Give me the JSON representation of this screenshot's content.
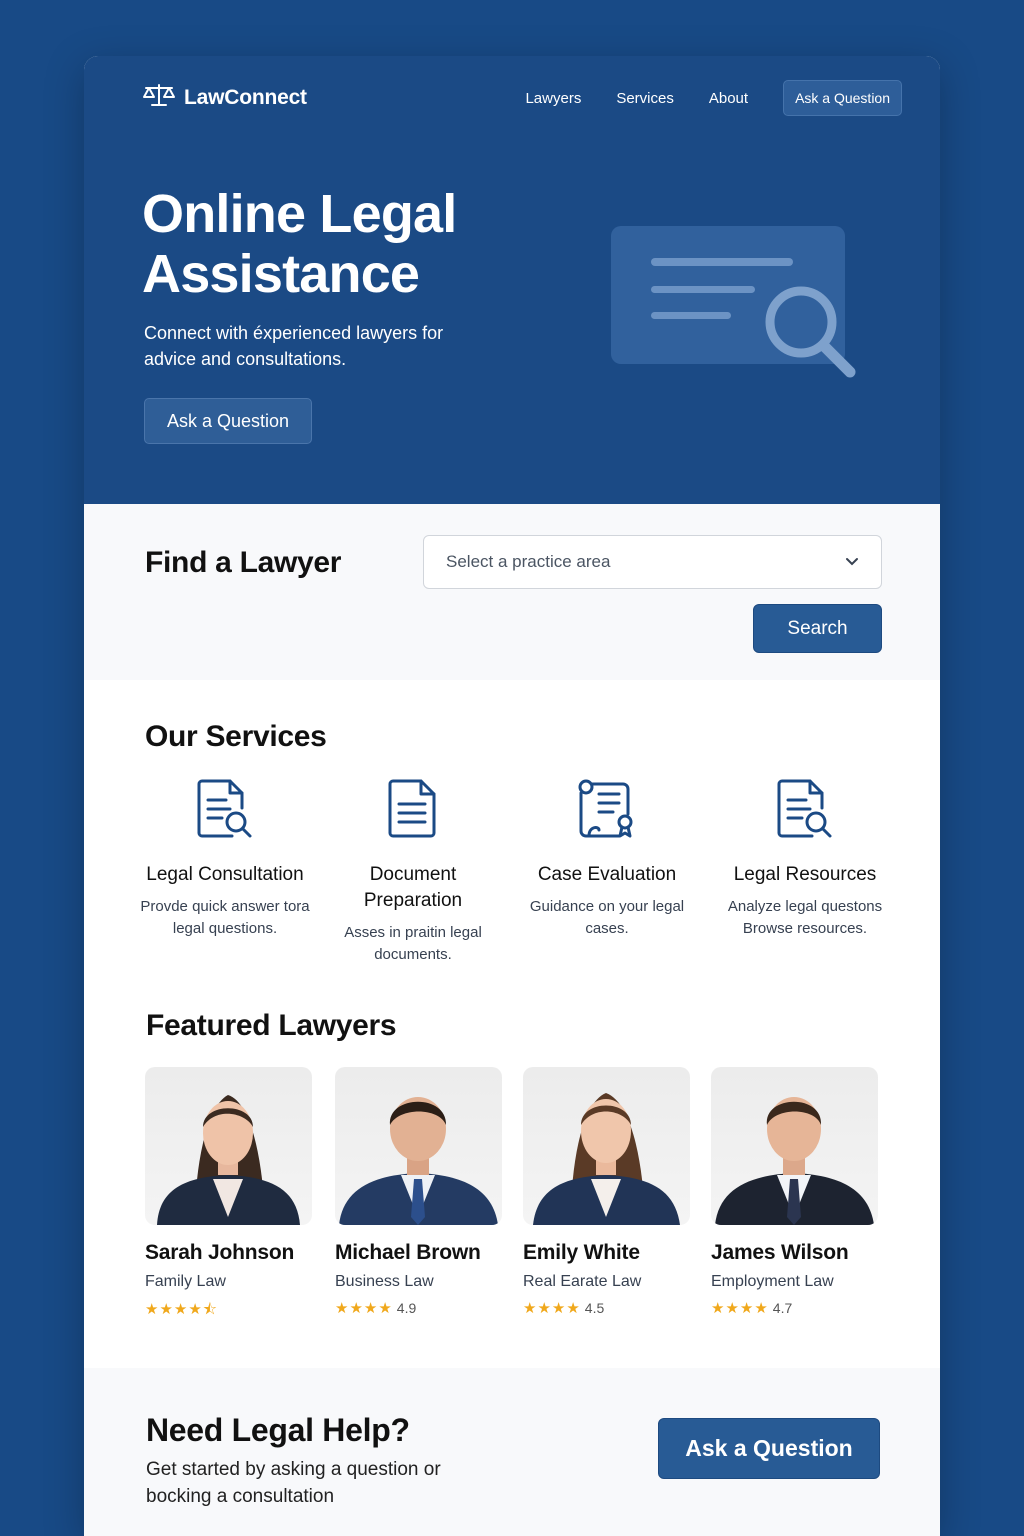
{
  "brand": {
    "name": "LawConnect",
    "logo_icon": "scales-icon"
  },
  "nav": {
    "items": [
      "Lawyers",
      "Services",
      "About"
    ],
    "cta": "Ask a Question"
  },
  "hero": {
    "title": "Online Legal Assistance",
    "subtitle": "Connect with éxperienced lawyers for advice and consultations.",
    "button": "Ask a Question"
  },
  "find": {
    "title": "Find a Lawyer",
    "select_placeholder": "Select a practice area",
    "button": "Search"
  },
  "services": {
    "title": "Our Services",
    "items": [
      {
        "icon": "document-search-icon",
        "name": "Legal Consultation",
        "desc": "Provde quick answer tora legal questions."
      },
      {
        "icon": "document-icon",
        "name": "Document Preparation",
        "desc": "Asses in praitin legal documents."
      },
      {
        "icon": "certificate-icon",
        "name": "Case Evaluation",
        "desc": "Guidance on your legal cases."
      },
      {
        "icon": "document-search-icon",
        "name": "Legal Resources",
        "desc": "Analyze legal questons Browse resources."
      }
    ]
  },
  "lawyers": {
    "title": "Featured Lawyers",
    "items": [
      {
        "name": "Sarah Johnson",
        "area": "Family Law",
        "stars": 4.5,
        "rating_text": ""
      },
      {
        "name": "Michael Brown",
        "area": "Business Law",
        "stars": 4,
        "rating_text": "4.9"
      },
      {
        "name": "Emily White",
        "area": "Real Earate Law",
        "stars": 4,
        "rating_text": "4.5"
      },
      {
        "name": "James Wilson",
        "area": "Employment Law",
        "stars": 4,
        "rating_text": "4.7"
      }
    ]
  },
  "cta": {
    "title": "Need Legal Help?",
    "subtitle": "Get started by asking a question or bocking a consultation",
    "button": "Ask a Question"
  },
  "colors": {
    "primary": "#1b4a85",
    "button": "#285b95",
    "star": "#f0a81c",
    "background": "#184a86"
  }
}
